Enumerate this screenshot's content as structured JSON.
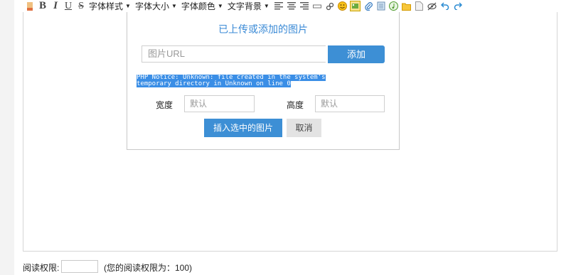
{
  "toolbar": {
    "font_style": "字体样式",
    "font_size": "字体大小",
    "font_color": "字体颜色",
    "text_bg": "文字背景",
    "caret": "▼",
    "bold": "B",
    "italic": "I",
    "underline": "U",
    "strike": "S"
  },
  "dialog": {
    "title": "已上传或添加的图片",
    "url_placeholder": "图片URL",
    "add_label": "添加",
    "notice": "PHP Notice:  Unknown: file created in the system's temporary directory in Unknown on line 0",
    "width_label": "宽度",
    "width_placeholder": "默认",
    "height_label": "高度",
    "height_placeholder": "默认",
    "insert_label": "插入选中的图片",
    "cancel_label": "取消"
  },
  "footer": {
    "permission_label": "阅读权限:",
    "permission_value": "",
    "permission_hint": "(您的阅读权限为：100)"
  },
  "colors": {
    "accent": "#3d8fd5",
    "title": "#3a8ad6",
    "selection": "#3a8ee6"
  }
}
